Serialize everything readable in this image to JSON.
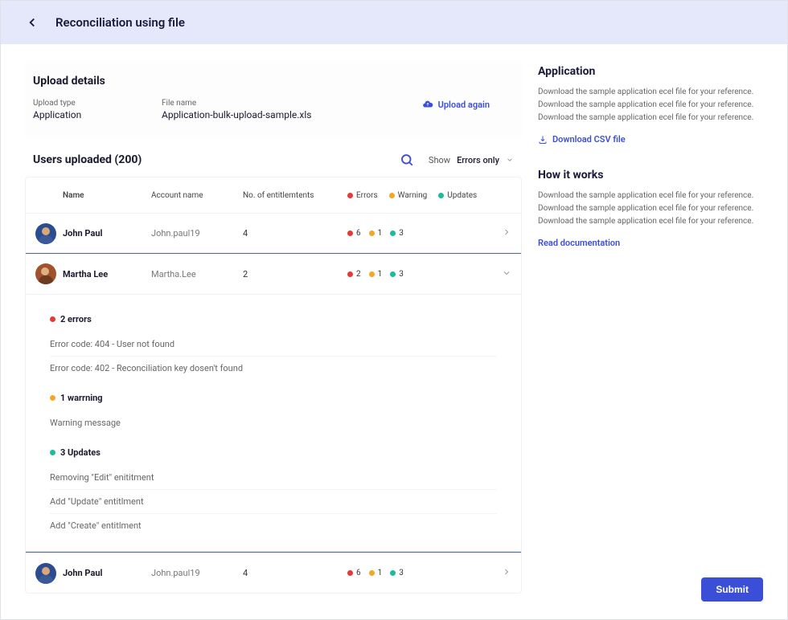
{
  "header": {
    "title": "Reconciliation using file"
  },
  "upload": {
    "heading": "Upload details",
    "type_label": "Upload type",
    "type_value": "Application",
    "file_label": "File name",
    "file_value": "Application-bulk-upload-sample.xls",
    "upload_again": "Upload again"
  },
  "users": {
    "heading": "Users uploaded (200)",
    "filter_label": "Show",
    "filter_value": "Errors only",
    "columns": {
      "name": "Name",
      "account": "Account name",
      "entitlements": "No. of entitlemtents",
      "errors": "Errors",
      "warning": "Warning",
      "updates": "Updates"
    },
    "rows": [
      {
        "name": "John Paul",
        "account": "John.paul19",
        "entitlements": "4",
        "errors": "6",
        "warnings": "1",
        "updates": "3"
      },
      {
        "name": "Martha Lee",
        "account": "Martha.Lee",
        "entitlements": "2",
        "errors": "2",
        "warnings": "1",
        "updates": "3"
      },
      {
        "name": "John Paul",
        "account": "John.paul19",
        "entitlements": "4",
        "errors": "6",
        "warnings": "1",
        "updates": "3"
      }
    ]
  },
  "expanded": {
    "errors_heading": "2 errors",
    "error_items": [
      "Error code: 404 - User not found",
      "Error code: 402 - Reconciliation key dosen't found"
    ],
    "warning_heading": "1 warrning",
    "warning_items": [
      "Warning message"
    ],
    "updates_heading": "3 Updates",
    "update_items": [
      "Removing \"Edit\" enititment",
      "Add \"Update\" entitlment",
      "Add \"Create\" entitlment"
    ]
  },
  "side": {
    "app_heading": "Application",
    "app_desc": "Download the sample application ecel file for your reference. Download the sample application ecel file for your reference. Download the sample application ecel file for your reference.",
    "app_link": "Download CSV file",
    "how_heading": "How it works",
    "how_desc": "Download the sample application ecel file for your reference. Download the sample application ecel file for your reference. Download the sample application ecel file for your reference.",
    "how_link": "Read documentation"
  },
  "submit": "Submit"
}
